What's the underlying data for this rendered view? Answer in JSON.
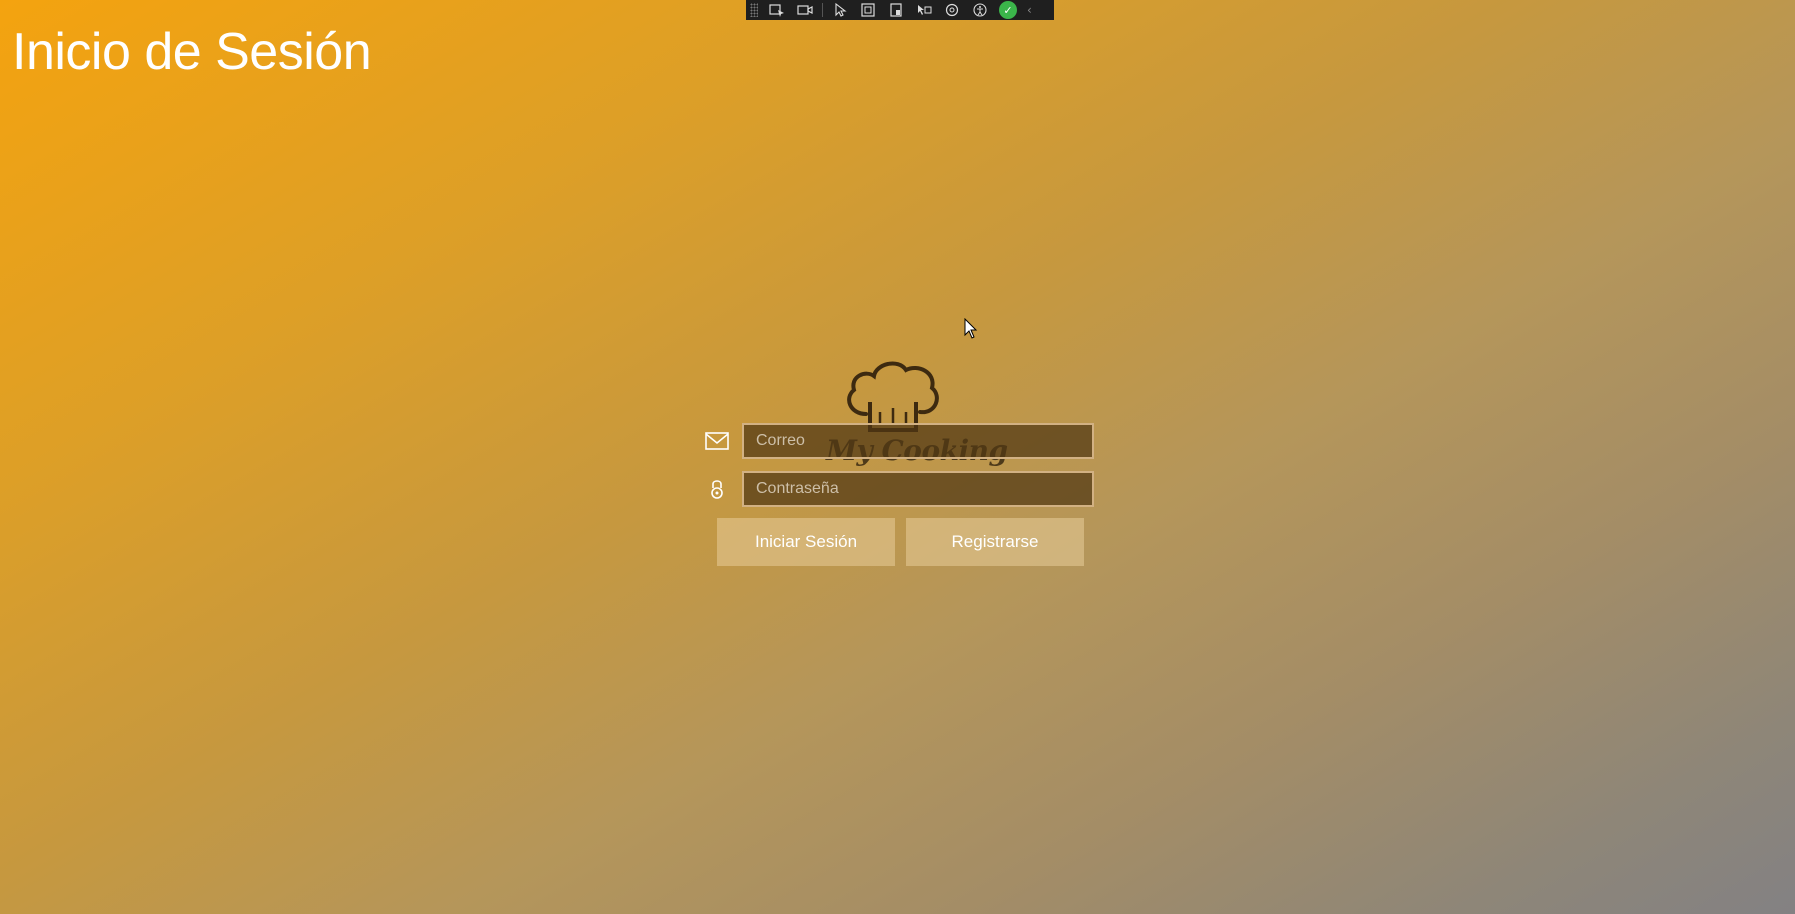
{
  "page": {
    "title": "Inicio de Sesión"
  },
  "dev_toolbar": {
    "icons": [
      "select-element-icon",
      "video-icon",
      "pointer-icon",
      "frame-icon",
      "layout-icon",
      "track-focus-icon",
      "display-layout-icon",
      "accessibility-icon",
      "binding-ok-icon",
      "collapse-icon"
    ]
  },
  "logo": {
    "text": "My Cooking",
    "icon": "chef-hat-icon"
  },
  "form": {
    "email": {
      "icon": "mail-icon",
      "placeholder": "Correo",
      "value": ""
    },
    "password": {
      "icon": "lock-icon",
      "placeholder": "Contraseña",
      "value": ""
    }
  },
  "buttons": {
    "login_label": "Iniciar Sesión",
    "register_label": "Registrarse"
  },
  "colors": {
    "background_start": "#f4a30f",
    "background_end": "#838183",
    "input_background": "#5a3d14",
    "input_border": "#d2b183",
    "button_background": "#d9bd8a",
    "text": "#ffffff"
  }
}
